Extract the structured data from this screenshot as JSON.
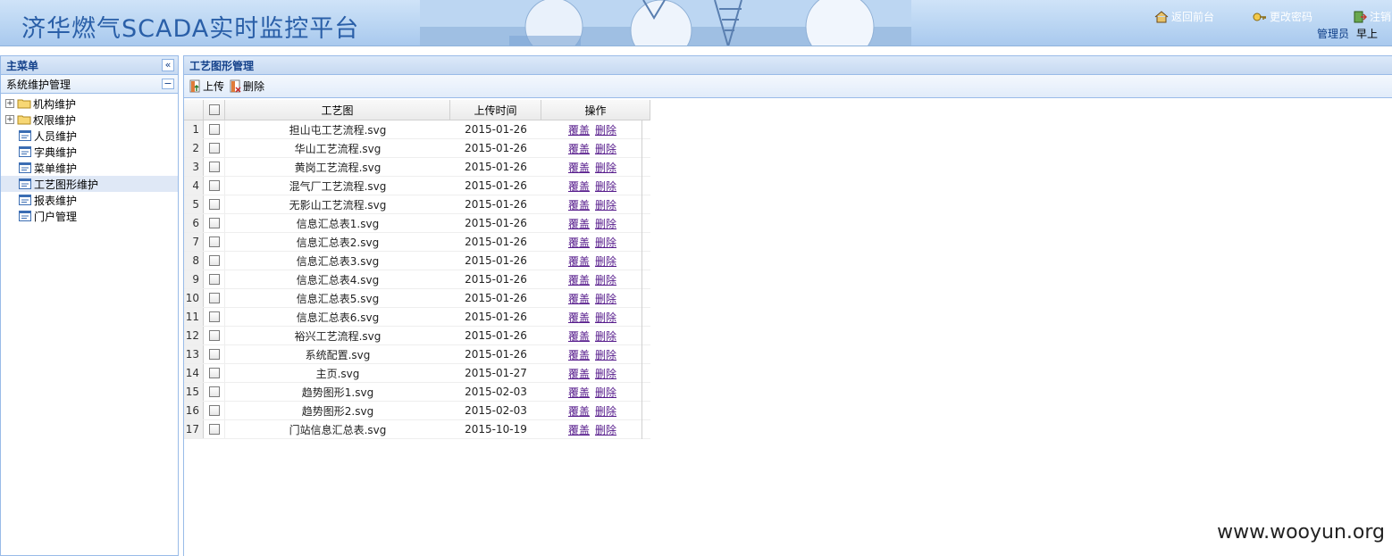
{
  "header": {
    "app_title": "济华燃气SCADA实时监控平台",
    "links": [
      {
        "label": "返回前台",
        "icon": "home-icon"
      },
      {
        "label": "更改密码",
        "icon": "key-icon"
      },
      {
        "label": "注销",
        "icon": "logout-icon"
      }
    ],
    "user_role": "管理员",
    "greeting": "早上"
  },
  "sidebar": {
    "title": "主菜单",
    "collapse_glyph": "«",
    "section_title": "系统维护管理",
    "section_toggle_glyph": "−",
    "items": [
      {
        "label": "机构维护",
        "type": "folder",
        "selected": false
      },
      {
        "label": "权限维护",
        "type": "folder",
        "selected": false
      },
      {
        "label": "人员维护",
        "type": "leaf",
        "selected": false
      },
      {
        "label": "字典维护",
        "type": "leaf",
        "selected": false
      },
      {
        "label": "菜单维护",
        "type": "leaf",
        "selected": false
      },
      {
        "label": "工艺图形维护",
        "type": "leaf",
        "selected": true
      },
      {
        "label": "报表维护",
        "type": "leaf",
        "selected": false
      },
      {
        "label": "门户管理",
        "type": "leaf",
        "selected": false
      }
    ]
  },
  "main": {
    "title": "工艺图形管理",
    "toolbar": {
      "upload_label": "上传",
      "delete_label": "删除"
    },
    "columns": {
      "name": "工艺图",
      "date": "上传时间",
      "op": "操作"
    },
    "op_labels": {
      "overwrite": "覆盖",
      "delete": "删除"
    },
    "rows": [
      {
        "num": "1",
        "name": "担山屯工艺流程.svg",
        "date": "2015-01-26"
      },
      {
        "num": "2",
        "name": "华山工艺流程.svg",
        "date": "2015-01-26"
      },
      {
        "num": "3",
        "name": "黄岗工艺流程.svg",
        "date": "2015-01-26"
      },
      {
        "num": "4",
        "name": "混气厂工艺流程.svg",
        "date": "2015-01-26"
      },
      {
        "num": "5",
        "name": "无影山工艺流程.svg",
        "date": "2015-01-26"
      },
      {
        "num": "6",
        "name": "信息汇总表1.svg",
        "date": "2015-01-26"
      },
      {
        "num": "7",
        "name": "信息汇总表2.svg",
        "date": "2015-01-26"
      },
      {
        "num": "8",
        "name": "信息汇总表3.svg",
        "date": "2015-01-26"
      },
      {
        "num": "9",
        "name": "信息汇总表4.svg",
        "date": "2015-01-26"
      },
      {
        "num": "10",
        "name": "信息汇总表5.svg",
        "date": "2015-01-26"
      },
      {
        "num": "11",
        "name": "信息汇总表6.svg",
        "date": "2015-01-26"
      },
      {
        "num": "12",
        "name": "裕兴工艺流程.svg",
        "date": "2015-01-26"
      },
      {
        "num": "13",
        "name": "系统配置.svg",
        "date": "2015-01-26"
      },
      {
        "num": "14",
        "name": "主页.svg",
        "date": "2015-01-27"
      },
      {
        "num": "15",
        "name": "趋势图形1.svg",
        "date": "2015-02-03"
      },
      {
        "num": "16",
        "name": "趋势图形2.svg",
        "date": "2015-02-03"
      },
      {
        "num": "17",
        "name": "门站信息汇总表.svg",
        "date": "2015-10-19"
      }
    ]
  },
  "watermark": "www.wooyun.org",
  "colors": {
    "title_blue": "#2a5fa8",
    "panel_title": "#15428b",
    "panel_border": "#99bbe8",
    "link_visited": "#551a8b"
  }
}
